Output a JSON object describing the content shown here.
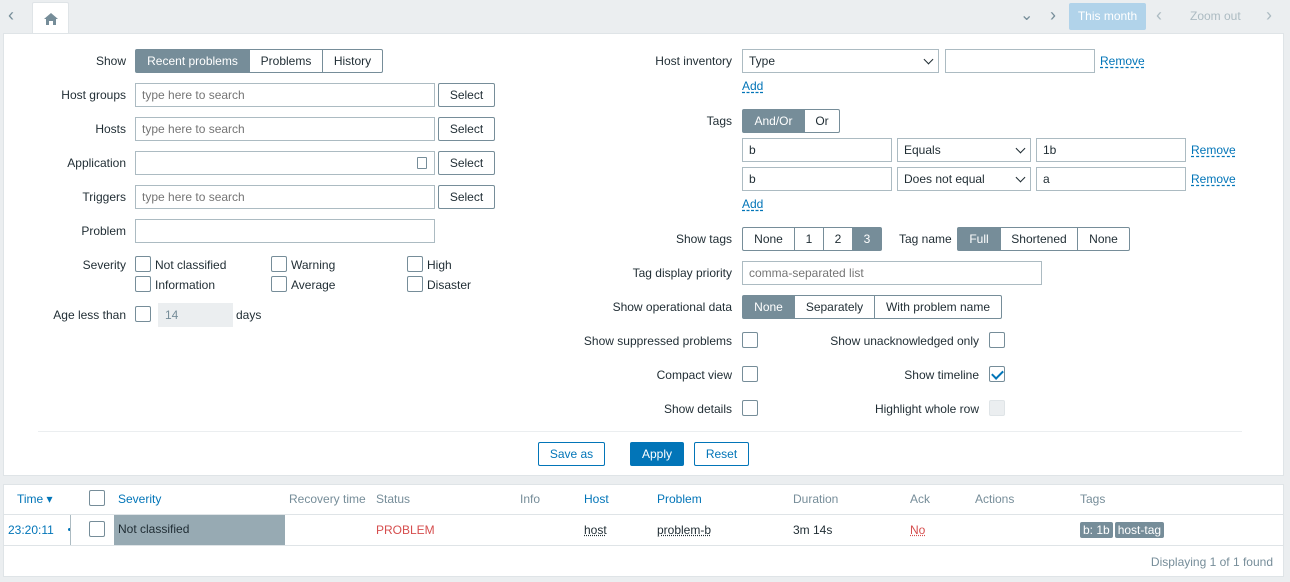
{
  "timebar": {
    "this_month": "This month",
    "zoom_out": "Zoom out"
  },
  "filter": {
    "show": {
      "label": "Show",
      "options": [
        "Recent problems",
        "Problems",
        "History"
      ],
      "active": 0
    },
    "host_groups": {
      "label": "Host groups",
      "placeholder": "type here to search",
      "select": "Select"
    },
    "hosts": {
      "label": "Hosts",
      "placeholder": "type here to search",
      "select": "Select"
    },
    "application": {
      "label": "Application",
      "select": "Select"
    },
    "triggers": {
      "label": "Triggers",
      "placeholder": "type here to search",
      "select": "Select"
    },
    "problem": {
      "label": "Problem"
    },
    "severity": {
      "label": "Severity",
      "options": [
        "Not classified",
        "Warning",
        "High",
        "Information",
        "Average",
        "Disaster"
      ]
    },
    "age": {
      "label": "Age less than",
      "value": "14",
      "unit": "days"
    },
    "host_inventory": {
      "label": "Host inventory",
      "field": "Type",
      "remove": "Remove",
      "add": "Add"
    },
    "tags": {
      "label": "Tags",
      "options": [
        "And/Or",
        "Or"
      ],
      "rows": [
        {
          "tag": "b",
          "operator": "Equals",
          "value": "1b",
          "remove": "Remove"
        },
        {
          "tag": "b",
          "operator": "Does not equal",
          "value": "a",
          "remove": "Remove"
        }
      ],
      "add": "Add"
    },
    "show_tags": {
      "label": "Show tags",
      "options": [
        "None",
        "1",
        "2",
        "3"
      ]
    },
    "tag_name": {
      "label": "Tag name",
      "options": [
        "Full",
        "Shortened",
        "None"
      ]
    },
    "tag_priority": {
      "label": "Tag display priority",
      "placeholder": "comma-separated list"
    },
    "operational": {
      "label": "Show operational data",
      "options": [
        "None",
        "Separately",
        "With problem name"
      ]
    },
    "suppressed": {
      "label": "Show suppressed problems"
    },
    "unack": {
      "label": "Show unacknowledged only"
    },
    "compact": {
      "label": "Compact view"
    },
    "timeline": {
      "label": "Show timeline"
    },
    "details": {
      "label": "Show details"
    },
    "highlight": {
      "label": "Highlight whole row"
    },
    "buttons": {
      "save_as": "Save as",
      "apply": "Apply",
      "reset": "Reset"
    }
  },
  "table": {
    "headers": {
      "time": "Time ▾",
      "severity": "Severity",
      "recovery": "Recovery time",
      "status": "Status",
      "info": "Info",
      "host": "Host",
      "problem": "Problem",
      "duration": "Duration",
      "ack": "Ack",
      "actions": "Actions",
      "tags": "Tags"
    },
    "row": {
      "time": "23:20:11",
      "severity": "Not classified",
      "status": "PROBLEM",
      "host": "host",
      "problem": "problem-b",
      "duration": "3m 14s",
      "ack": "No",
      "tags": [
        "b: 1b",
        "host-tag"
      ]
    },
    "footer": "Displaying 1 of 1 found"
  },
  "colors": {
    "accent": "#0275b8",
    "problem": "#d64e4e",
    "not_classified": "#97aab3"
  }
}
